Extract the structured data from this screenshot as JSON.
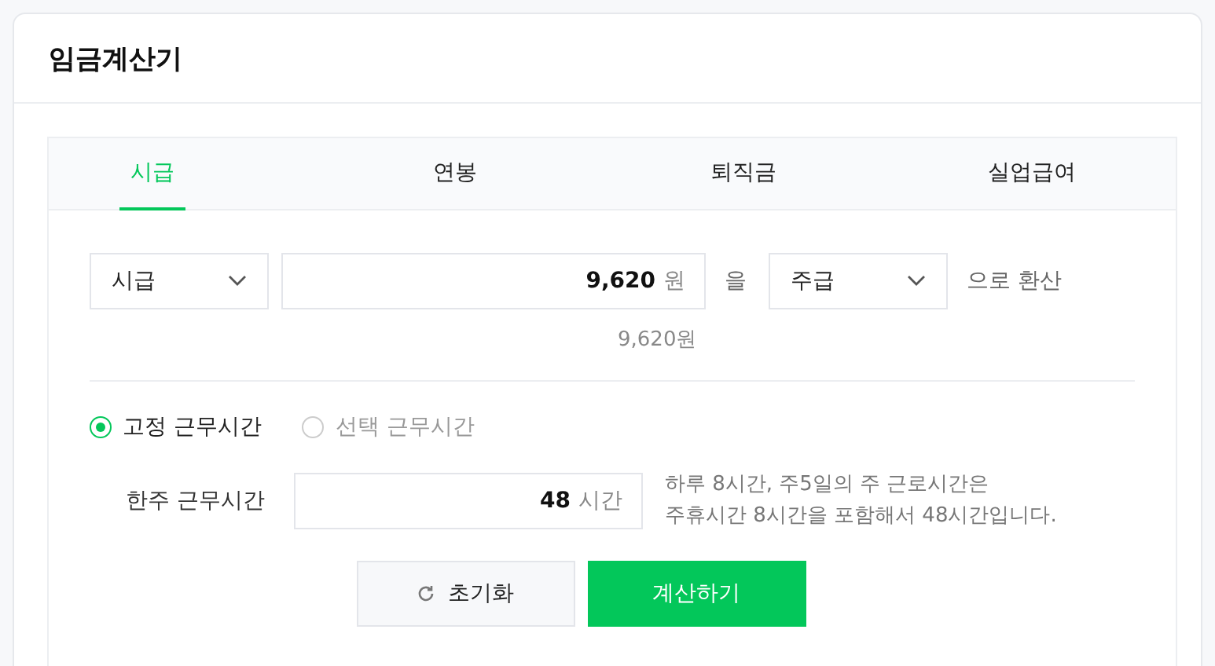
{
  "title": "임금계산기",
  "tabs": [
    {
      "label": "시급",
      "selected": true
    },
    {
      "label": "연봉",
      "selected": false
    },
    {
      "label": "퇴직금",
      "selected": false
    },
    {
      "label": "실업급여",
      "selected": false
    }
  ],
  "conversion": {
    "from_unit": "시급",
    "amount": "9,620",
    "currency": "원",
    "particle": "을",
    "to_unit": "주급",
    "suffix": "으로 환산",
    "amount_preview": "9,620원"
  },
  "hour_modes": [
    {
      "label": "고정 근무시간",
      "selected": true
    },
    {
      "label": "선택 근무시간",
      "selected": false
    }
  ],
  "weekly_hours": {
    "label": "한주 근무시간",
    "value": "48",
    "unit": "시간",
    "note": "하루 8시간, 주5일의 주 근로시간은\n주휴시간 8시간을 포함해서 48시간입니다."
  },
  "buttons": {
    "reset": "초기화",
    "calculate": "계산하기"
  }
}
